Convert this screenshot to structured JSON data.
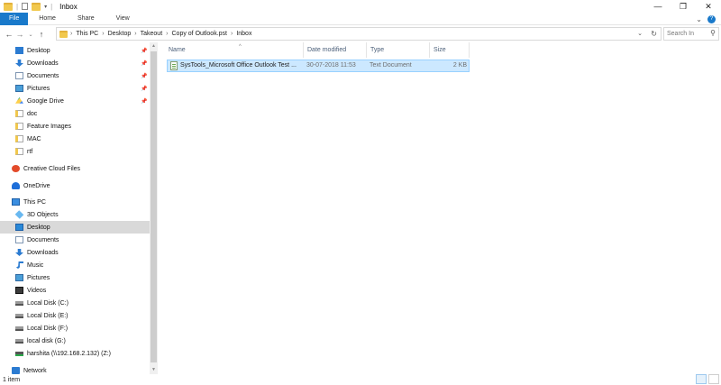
{
  "window": {
    "title": "Inbox",
    "controls": {
      "minimize": "—",
      "restore": "❐",
      "close": "✕"
    }
  },
  "ribbon": {
    "tabs": [
      "File",
      "Home",
      "Share",
      "View"
    ],
    "expand_icon": "chevron-down-icon",
    "help_icon": "help-icon"
  },
  "address": {
    "breadcrumbs": [
      "This PC",
      "Desktop",
      "Takeout",
      "Copy of Outlook.pst",
      "Inbox"
    ],
    "search_placeholder": "Search In"
  },
  "nav": {
    "items": [
      {
        "label": "Desktop",
        "icon": "desktop-icon",
        "pinned": true
      },
      {
        "label": "Downloads",
        "icon": "download-icon",
        "pinned": true
      },
      {
        "label": "Documents",
        "icon": "documents-icon",
        "pinned": true
      },
      {
        "label": "Pictures",
        "icon": "pictures-icon",
        "pinned": true
      },
      {
        "label": "Google Drive",
        "icon": "google-drive-icon",
        "pinned": true
      },
      {
        "label": "doc",
        "icon": "folder-icon",
        "pinned": false
      },
      {
        "label": "Feature Images",
        "icon": "folder-icon",
        "pinned": false
      },
      {
        "label": "MAC",
        "icon": "folder-icon",
        "pinned": false
      },
      {
        "label": "rtf",
        "icon": "folder-icon",
        "pinned": false
      },
      {
        "label": "Creative Cloud Files",
        "icon": "creative-cloud-icon",
        "pinned": false
      },
      {
        "label": "OneDrive",
        "icon": "onedrive-icon",
        "pinned": false
      },
      {
        "label": "This PC",
        "icon": "this-pc-icon",
        "pinned": false
      },
      {
        "label": "3D Objects",
        "icon": "3d-objects-icon",
        "pinned": false
      },
      {
        "label": "Desktop",
        "icon": "desktop-icon",
        "pinned": false,
        "selected": true
      },
      {
        "label": "Documents",
        "icon": "documents-icon",
        "pinned": false
      },
      {
        "label": "Downloads",
        "icon": "download-icon",
        "pinned": false
      },
      {
        "label": "Music",
        "icon": "music-icon",
        "pinned": false
      },
      {
        "label": "Pictures",
        "icon": "pictures-icon",
        "pinned": false
      },
      {
        "label": "Videos",
        "icon": "videos-icon",
        "pinned": false
      },
      {
        "label": "Local Disk (C:)",
        "icon": "drive-icon",
        "pinned": false
      },
      {
        "label": "Local Disk (E:)",
        "icon": "drive-icon",
        "pinned": false
      },
      {
        "label": "Local Disk (F:)",
        "icon": "drive-icon",
        "pinned": false
      },
      {
        "label": "local disk (G:)",
        "icon": "drive-icon",
        "pinned": false
      },
      {
        "label": "harshita (\\\\192.168.2.132) (Z:)",
        "icon": "network-drive-icon",
        "pinned": false
      },
      {
        "label": "Network",
        "icon": "network-icon",
        "pinned": false
      }
    ]
  },
  "columns": {
    "name": "Name",
    "date": "Date modified",
    "type": "Type",
    "size": "Size"
  },
  "files": [
    {
      "name": "SysTools_Microsoft Office Outlook Test ...",
      "date": "30-07-2018 11:53",
      "type": "Text Document",
      "size": "2 KB"
    }
  ],
  "status": {
    "item_count": "1 item"
  },
  "colors": {
    "accent": "#1979ca",
    "selection": "#cce8ff",
    "nav_selected": "#d9d9d9"
  }
}
